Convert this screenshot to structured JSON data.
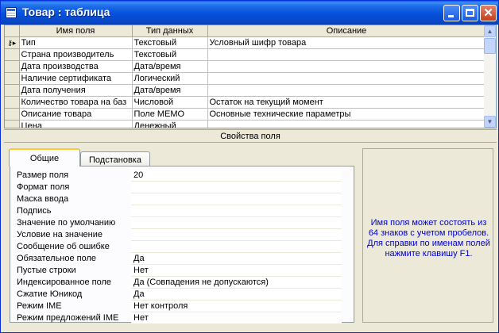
{
  "window": {
    "title": "Товар : таблица"
  },
  "grid": {
    "columns": [
      "Имя поля",
      "Тип данных",
      "Описание"
    ],
    "rows": [
      [
        "Тип",
        "Текстовый",
        "Условный шифр товара"
      ],
      [
        "Страна производитель",
        "Текстовый",
        ""
      ],
      [
        "Дата производства",
        "Дата/время",
        ""
      ],
      [
        "Наличие сертификата",
        "Логический",
        ""
      ],
      [
        "Дата получения",
        "Дата/время",
        ""
      ],
      [
        "Количество товара на баз",
        "Числовой",
        "Остаток на текущий момент"
      ],
      [
        "Описание товара",
        "Поле MEMO",
        "Основные технические параметры"
      ],
      [
        "Цена",
        "Денежный",
        ""
      ],
      [
        "",
        "",
        ""
      ]
    ]
  },
  "properties": {
    "header": "Свойства поля",
    "tabs": [
      "Общие",
      "Подстановка"
    ],
    "rows": [
      {
        "label": "Размер поля",
        "value": "20"
      },
      {
        "label": "Формат поля",
        "value": ""
      },
      {
        "label": "Маска ввода",
        "value": ""
      },
      {
        "label": "Подпись",
        "value": ""
      },
      {
        "label": "Значение по умолчанию",
        "value": ""
      },
      {
        "label": "Условие на значение",
        "value": ""
      },
      {
        "label": "Сообщение об ошибке",
        "value": ""
      },
      {
        "label": "Обязательное поле",
        "value": "Да"
      },
      {
        "label": "Пустые строки",
        "value": "Нет"
      },
      {
        "label": "Индексированное поле",
        "value": "Да (Совпадения не допускаются)"
      },
      {
        "label": "Сжатие Юникод",
        "value": "Да"
      },
      {
        "label": "Режим IME",
        "value": "Нет контроля"
      },
      {
        "label": "Режим предложений IME",
        "value": "Нет"
      }
    ],
    "help": "Имя поля может состоять из 64 знаков с учетом пробелов.  Для справки по именам полей нажмите клавишу F1."
  }
}
